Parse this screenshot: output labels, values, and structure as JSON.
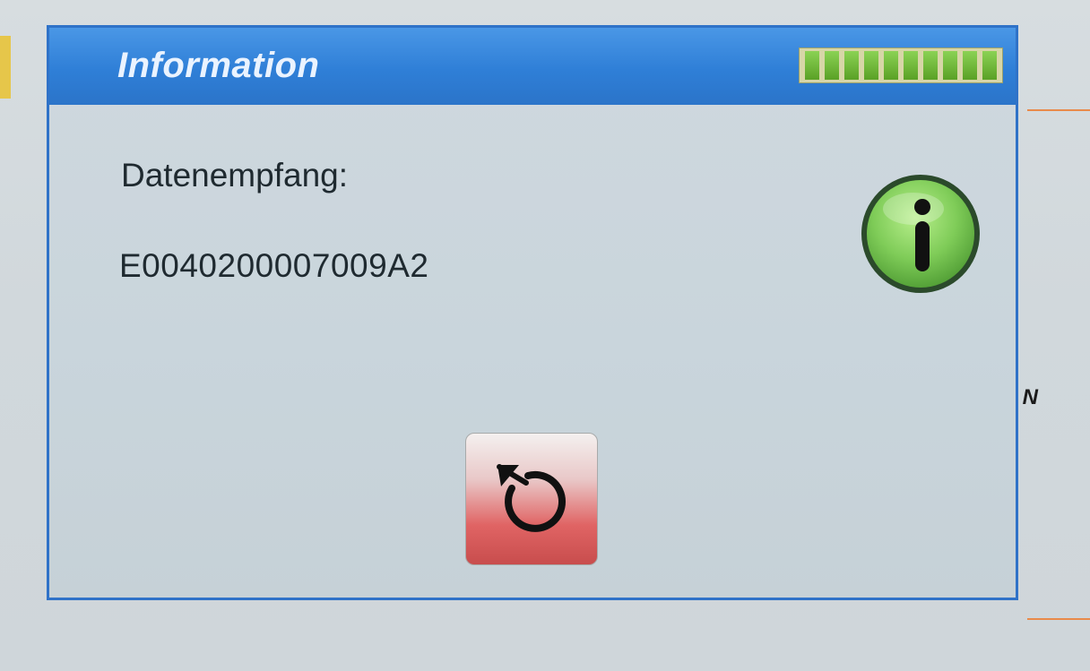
{
  "dialog": {
    "title": "Information",
    "label": "Datenempfang:",
    "value": "E0040200007009A2",
    "signal_level": 1.0
  },
  "background": {
    "fragment_text": "N"
  },
  "icons": {
    "info": "info-icon",
    "back": "undo-arrow-icon",
    "signal": "signal-strength-icon"
  },
  "colors": {
    "titlebar": "#2f7fd7",
    "border": "#2f72c8",
    "info_green": "#74c45a",
    "button_red": "#e06464",
    "signal_green": "#6cb63a"
  }
}
